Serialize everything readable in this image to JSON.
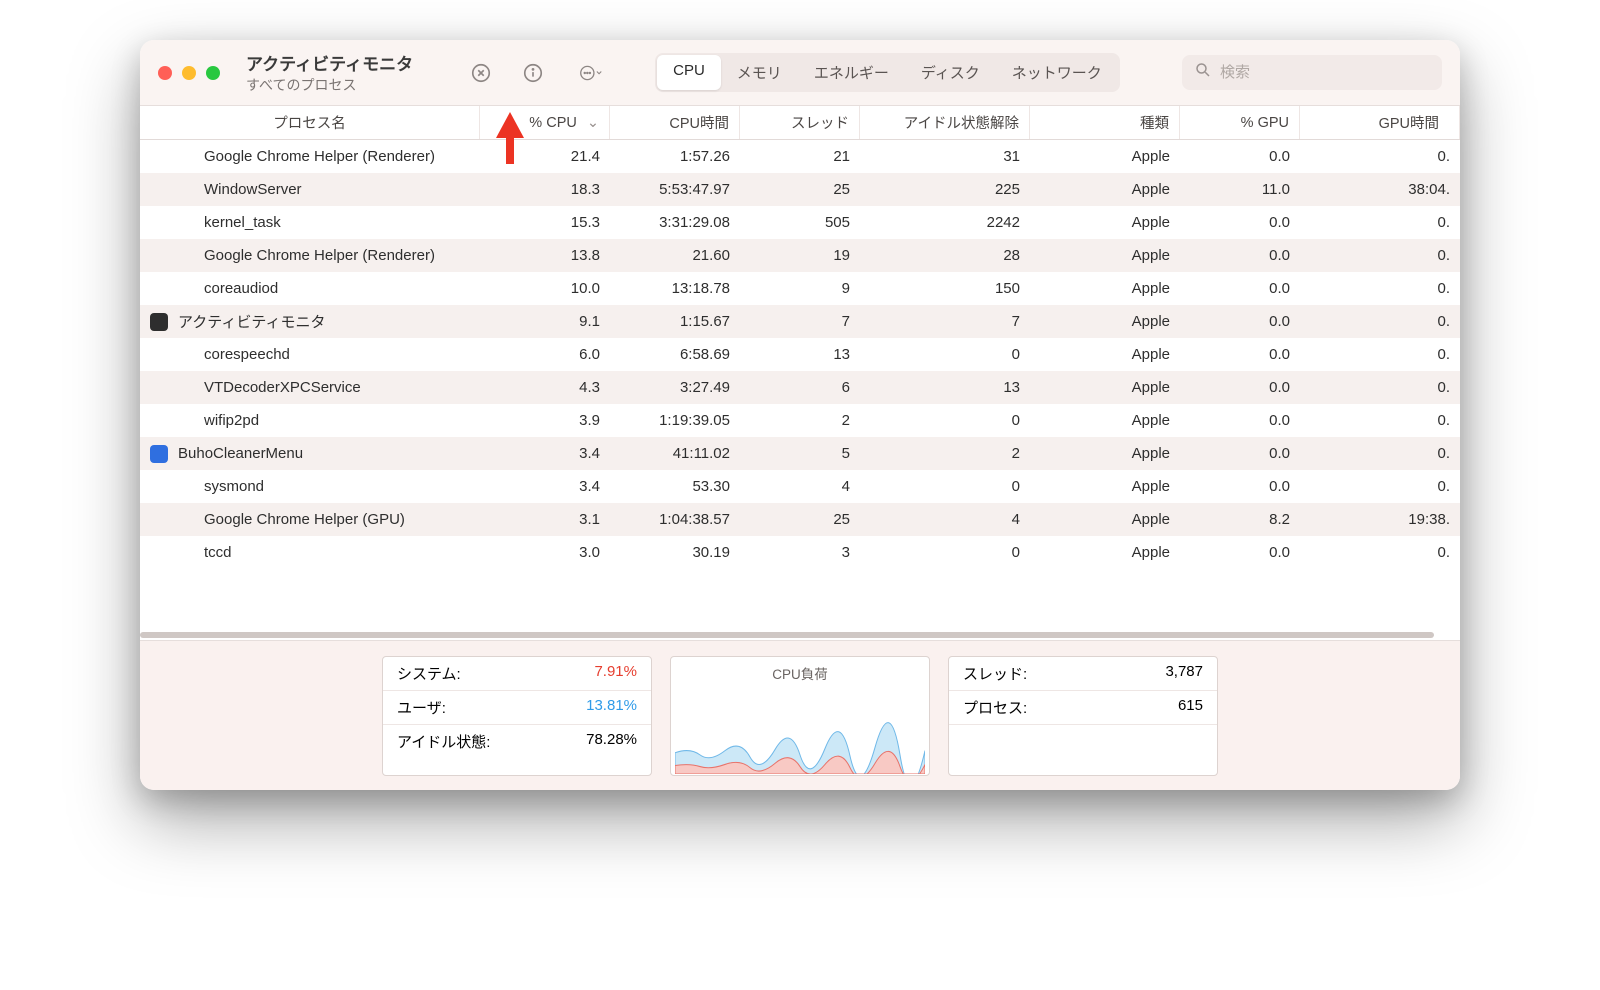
{
  "window": {
    "title": "アクティビティモニタ",
    "subtitle": "すべてのプロセス"
  },
  "search": {
    "placeholder": "検索"
  },
  "tabs": [
    {
      "label": "CPU",
      "active": true
    },
    {
      "label": "メモリ"
    },
    {
      "label": "エネルギー"
    },
    {
      "label": "ディスク"
    },
    {
      "label": "ネットワーク"
    }
  ],
  "columns": {
    "name": "プロセス名",
    "cpu": "% CPU",
    "time": "CPU時間",
    "threads": "スレッド",
    "idle": "アイドル状態解除",
    "kind": "種類",
    "gpu": "% GPU",
    "gputime": "GPU時間"
  },
  "rows": [
    {
      "name": "Google Chrome Helper (Renderer)",
      "cpu": "21.4",
      "time": "1:57.26",
      "threads": "21",
      "idle": "31",
      "kind": "Apple",
      "gpu": "0.0",
      "gputime": "0."
    },
    {
      "name": "WindowServer",
      "cpu": "18.3",
      "time": "5:53:47.97",
      "threads": "25",
      "idle": "225",
      "kind": "Apple",
      "gpu": "11.0",
      "gputime": "38:04."
    },
    {
      "name": "kernel_task",
      "cpu": "15.3",
      "time": "3:31:29.08",
      "threads": "505",
      "idle": "2242",
      "kind": "Apple",
      "gpu": "0.0",
      "gputime": "0."
    },
    {
      "name": "Google Chrome Helper (Renderer)",
      "cpu": "13.8",
      "time": "21.60",
      "threads": "19",
      "idle": "28",
      "kind": "Apple",
      "gpu": "0.0",
      "gputime": "0."
    },
    {
      "name": "coreaudiod",
      "cpu": "10.0",
      "time": "13:18.78",
      "threads": "9",
      "idle": "150",
      "kind": "Apple",
      "gpu": "0.0",
      "gputime": "0."
    },
    {
      "name": "アクティビティモニタ",
      "icon": "activity",
      "cpu": "9.1",
      "time": "1:15.67",
      "threads": "7",
      "idle": "7",
      "kind": "Apple",
      "gpu": "0.0",
      "gputime": "0."
    },
    {
      "name": "corespeechd",
      "cpu": "6.0",
      "time": "6:58.69",
      "threads": "13",
      "idle": "0",
      "kind": "Apple",
      "gpu": "0.0",
      "gputime": "0."
    },
    {
      "name": "VTDecoderXPCService",
      "cpu": "4.3",
      "time": "3:27.49",
      "threads": "6",
      "idle": "13",
      "kind": "Apple",
      "gpu": "0.0",
      "gputime": "0."
    },
    {
      "name": "wifip2pd",
      "cpu": "3.9",
      "time": "1:19:39.05",
      "threads": "2",
      "idle": "0",
      "kind": "Apple",
      "gpu": "0.0",
      "gputime": "0."
    },
    {
      "name": "BuhoCleanerMenu",
      "icon": "buho",
      "cpu": "3.4",
      "time": "41:11.02",
      "threads": "5",
      "idle": "2",
      "kind": "Apple",
      "gpu": "0.0",
      "gputime": "0."
    },
    {
      "name": "sysmond",
      "cpu": "3.4",
      "time": "53.30",
      "threads": "4",
      "idle": "0",
      "kind": "Apple",
      "gpu": "0.0",
      "gputime": "0."
    },
    {
      "name": "Google Chrome Helper (GPU)",
      "cpu": "3.1",
      "time": "1:04:38.57",
      "threads": "25",
      "idle": "4",
      "kind": "Apple",
      "gpu": "8.2",
      "gputime": "19:38."
    },
    {
      "name": "tccd",
      "cpu": "3.0",
      "time": "30.19",
      "threads": "3",
      "idle": "0",
      "kind": "Apple",
      "gpu": "0.0",
      "gputime": "0."
    }
  ],
  "footer": {
    "system_label": "システム:",
    "system_value": "7.91%",
    "user_label": "ユーザ:",
    "user_value": "13.81%",
    "idle_label": "アイドル状態:",
    "idle_value": "78.28%",
    "chart_title": "CPU負荷",
    "threads_label": "スレッド:",
    "threads_value": "3,787",
    "procs_label": "プロセス:",
    "procs_value": "615"
  }
}
